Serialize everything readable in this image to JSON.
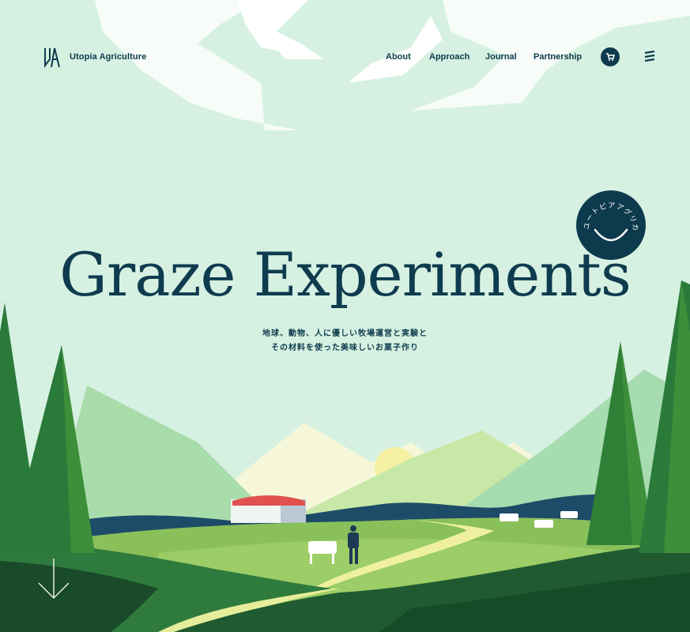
{
  "header": {
    "brand": "Utopia Agriculture",
    "nav": [
      "About",
      "Approach",
      "Journal",
      "Partnership"
    ]
  },
  "hero": {
    "title": "Graze Experiments",
    "subtitle_lines": [
      "地球、動物、人に優しい牧場運営と実験と",
      "その材料を使った美味しいお菓子作り"
    ]
  },
  "badge": {
    "text": "ユートピアアグリカルチャー"
  },
  "icons": {
    "cart": "cart-icon",
    "menu": "hamburger-menu-icon",
    "scroll": "arrow-down-icon",
    "logo": "ua-logo-icon"
  },
  "colors": {
    "navy": "#0d3a4c",
    "sky": "#d6f1e2",
    "grass": "#8ac05a",
    "forest": "#1f5a30",
    "roof": "#e0514f"
  }
}
